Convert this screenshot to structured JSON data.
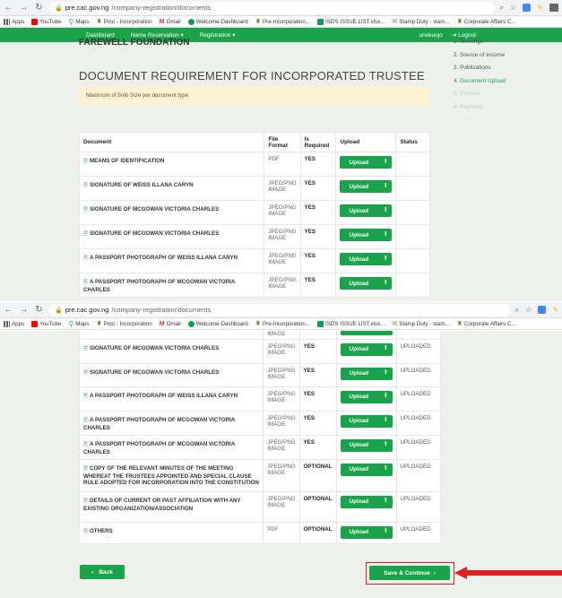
{
  "browser": {
    "url_host": "pre.cac.gov.ng",
    "url_path": "/company-registration/documents",
    "bookmarks": [
      {
        "label": "Apps",
        "icon": "apps-grid-icon"
      },
      {
        "label": "YouTube",
        "icon": "youtube-icon"
      },
      {
        "label": "Maps",
        "icon": "maps-pin-icon"
      },
      {
        "label": "Post - Incorporation",
        "icon": "coat-of-arms-icon"
      },
      {
        "label": "Gmail",
        "icon": "gmail-icon"
      },
      {
        "label": "Welcome-Dashboard",
        "icon": "globe-icon"
      },
      {
        "label": "Pre-Incorporation...",
        "icon": "coat-of-arms-icon"
      },
      {
        "label": "ISDS ISSUE LIST.xlsx...",
        "icon": "sheets-icon"
      },
      {
        "label": "Stamp Duty - stam...",
        "icon": "stamp-icon"
      },
      {
        "label": "Corporate Affairs C...",
        "icon": "coat-of-arms-icon"
      }
    ]
  },
  "site_nav": {
    "dashboard": "Dashboard",
    "name_reservation": "Name Reservation",
    "registration": "Registration",
    "user": "unekuojo",
    "logout": "Logout"
  },
  "org_name": "FAREWELL FOUNDATION",
  "page_title": "DOCUMENT REQUIREMENT FOR INCORPORATED TRUSTEE",
  "notice": "Maximum of 5mb Size per document type",
  "steps": [
    {
      "label": "1. Meetings",
      "state": "done"
    },
    {
      "label": "2. Source of Income",
      "state": "done"
    },
    {
      "label": "3. Publications",
      "state": "done"
    },
    {
      "label": "4. Document Upload",
      "state": "active"
    },
    {
      "label": "5. Preview",
      "state": "pending"
    },
    {
      "label": "6. Payment",
      "state": "pending"
    }
  ],
  "table_headers": {
    "document": "Document",
    "format": "File Format",
    "required": "Is Required",
    "upload": "Upload",
    "status": "Status"
  },
  "upload_label": "Upload",
  "rows_top": [
    {
      "doc": "MEANS OF IDENTIFICATION",
      "format": "PDF",
      "required": "YES",
      "status": ""
    },
    {
      "doc": "SIGNATURE OF WEISS ILLANA CARYN",
      "format": "JPEG/PNG IMAGE",
      "required": "YES",
      "status": ""
    },
    {
      "doc": "SIGNATURE OF MCGOWAN VICTORIA CHARLES",
      "format": "JPEG/PNG IMAGE",
      "required": "YES",
      "status": ""
    },
    {
      "doc": "SIGNATURE OF MCGOWAN VICTORIA CHARLES",
      "format": "JPEG/PNG IMAGE",
      "required": "YES",
      "status": ""
    },
    {
      "doc": "A PASSPORT PHOTOGRAPH OF WEISS ILLANA CARYN",
      "format": "JPEG/PNG IMAGE",
      "required": "YES",
      "status": ""
    },
    {
      "doc": "A PASSPORT PHOTOGRAPH OF MCGOWAN VICTORIA CHARLES",
      "format": "JPEG/PNG IMAGE",
      "required": "YES",
      "status": ""
    }
  ],
  "rows_bottom_cut_label": "IMAGE",
  "rows_bottom": [
    {
      "doc": "SIGNATURE OF MCGOWAN VICTORIA CHARLES",
      "format": "JPEG/PNG IMAGE",
      "required": "YES",
      "status": "UPLOADED"
    },
    {
      "doc": "SIGNATURE OF MCGOWAN VICTORIA CHARLES",
      "format": "JPEG/PNG IMAGE",
      "required": "YES",
      "status": "UPLOADED"
    },
    {
      "doc": "A PASSPORT PHOTOGRAPH OF WEISS ILLANA CARYN",
      "format": "JPEG/PNG IMAGE",
      "required": "YES",
      "status": "UPLOADED"
    },
    {
      "doc": "A PASSPORT PHOTOGRAPH OF MCGOWAN VICTORIA CHARLES",
      "format": "JPEG/PNG IMAGE",
      "required": "YES",
      "status": "UPLOADED"
    },
    {
      "doc": "A PASSPORT PHOTOGRAPH OF MCGOWAN VICTORIA CHARLES",
      "format": "JPEG/PNG IMAGE",
      "required": "YES",
      "status": "UPLOADED"
    },
    {
      "doc": "COPY OF THE RELEVANT MINUTES OF THE MEETING WHEREAT THE TRUSTEES APPOINTED AND SPECIAL CLAUSE RULE ADOPTED FOR INCORPORATION INTO THE CONSTITUTION",
      "format": "JPEG/PNG IMAGE",
      "required": "OPTIONAL",
      "status": "UPLOADED"
    },
    {
      "doc": "DETAILS OF CURRENT OR PAST AFFILIATION WITH ANY EXISTING ORGANIZATION/ASSOCIATION",
      "format": "JPEG/PNG IMAGE",
      "required": "OPTIONAL",
      "status": "UPLOADED"
    },
    {
      "doc": "OTHERS",
      "format": "PDF",
      "required": "OPTIONAL",
      "status": "UPLOADED"
    }
  ],
  "back_label": "Back",
  "save_label": "Save & Continue",
  "colors": {
    "primary_green": "#19a34a",
    "highlight_red": "#e02020",
    "notice_bg": "#fdf1d3"
  }
}
